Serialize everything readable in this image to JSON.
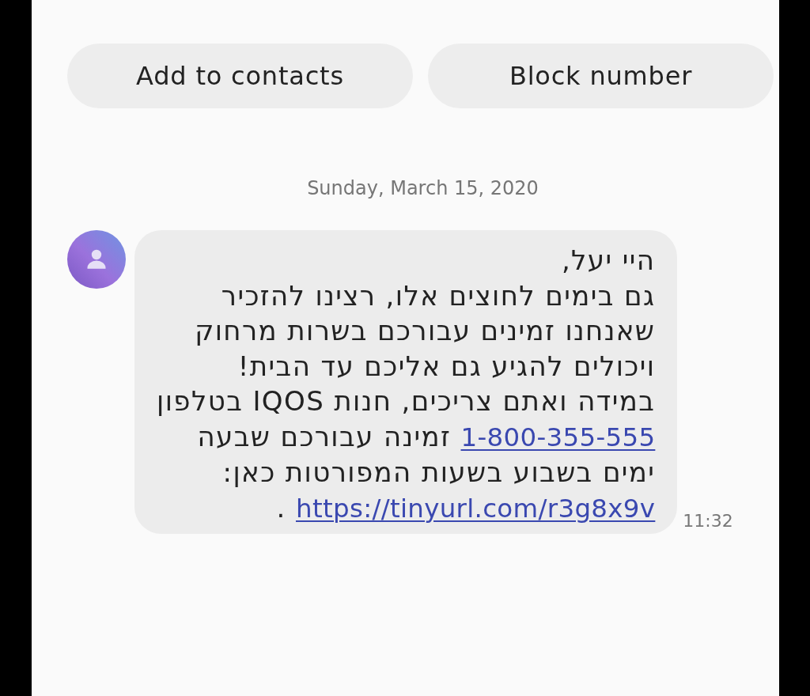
{
  "add_contact_button": {
    "label": "Add to contacts"
  },
  "block_number_button": {
    "label": "Block number"
  },
  "date": "Sunday, March 15, 2020",
  "message": {
    "lines": [
      [
        {
          "kind": "text",
          "text": "היי יעל,"
        }
      ],
      [
        {
          "kind": "text",
          "text": "גם בימים לחוצים אלו, רצינו להזכיר"
        }
      ],
      [
        {
          "kind": "text",
          "text": "שאנחנו זמינים עבורכם בשרות מרחוק"
        }
      ],
      [
        {
          "kind": "text",
          "text": "ויכולים להגיע גם אליכם עד הבית!"
        }
      ],
      [
        {
          "kind": "text",
          "text": "במידה ואתם צריכים, חנות IQOS בטלפון"
        }
      ],
      [
        {
          "kind": "phone",
          "text": "1-800-355-555"
        },
        {
          "kind": "text",
          "text": "זמינה עבורכם שבעה"
        }
      ],
      [
        {
          "kind": "text",
          "text": "ימים בשבוע בשעות המפורטות כאן:"
        }
      ],
      [
        {
          "kind": "url",
          "text": "https://tinyurl.com/r3g8x9v"
        },
        {
          "kind": "text",
          "text": "."
        }
      ]
    ],
    "time": "11:32"
  }
}
